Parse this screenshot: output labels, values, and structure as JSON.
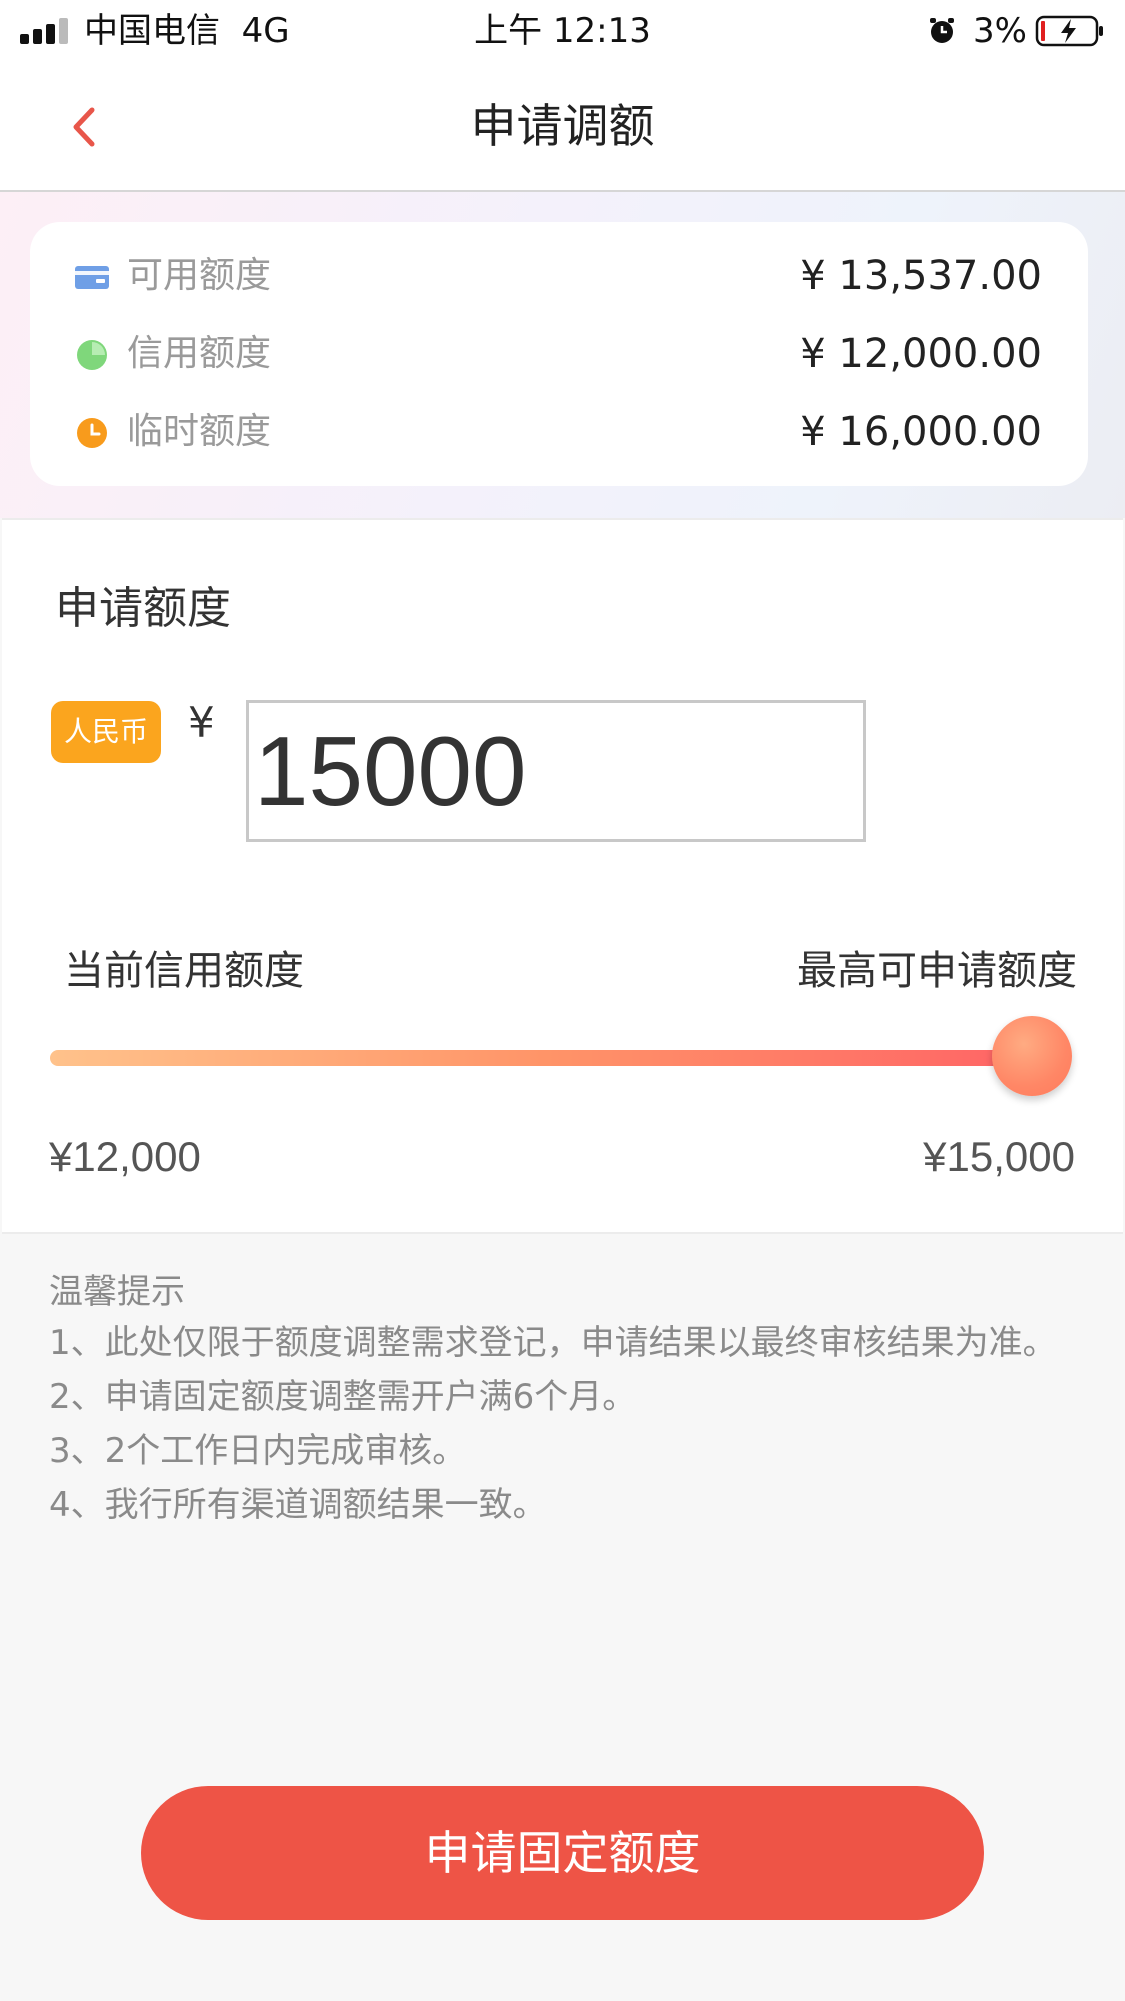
{
  "status_bar": {
    "carrier": "中国电信",
    "network": "4G",
    "time": "上午 12:13",
    "battery": "3%",
    "alarm_icon": "alarm-clock-icon",
    "battery_icon": "battery-charging-icon",
    "signal_icon": "signal-bars-icon"
  },
  "nav": {
    "title": "申请调额",
    "back_icon": "chevron-left-icon",
    "accent_color": "#e8564a"
  },
  "summary": {
    "items": [
      {
        "label": "可用额度",
        "value": "¥ 13,537.00",
        "icon": "card-icon",
        "icon_color": "#6f9fe6"
      },
      {
        "label": "信用额度",
        "value": "¥ 12,000.00",
        "icon": "pie-chart-icon",
        "icon_color": "#7fd77b"
      },
      {
        "label": "临时额度",
        "value": "¥ 16,000.00",
        "icon": "clock-icon",
        "icon_color": "#f89b1c"
      }
    ]
  },
  "apply": {
    "title": "申请额度",
    "currency_badge": "人民币",
    "currency_symbol": "¥",
    "amount": "15000",
    "range_left_label": "当前信用额度",
    "range_right_label": "最高可申请额度",
    "min_value": "¥12,000",
    "max_value": "¥15,000",
    "slider_fraction": 1.0
  },
  "tips": {
    "title": "温馨提示",
    "lines": [
      "1、此处仅限于额度调整需求登记，申请结果以最终审核结果为准。",
      "2、申请固定额度调整需开户满6个月。",
      "3、2个工作日内完成审核。",
      "4、我行所有渠道调额结果一致。"
    ]
  },
  "submit": {
    "label": "申请固定额度",
    "color": "#ee5446"
  }
}
